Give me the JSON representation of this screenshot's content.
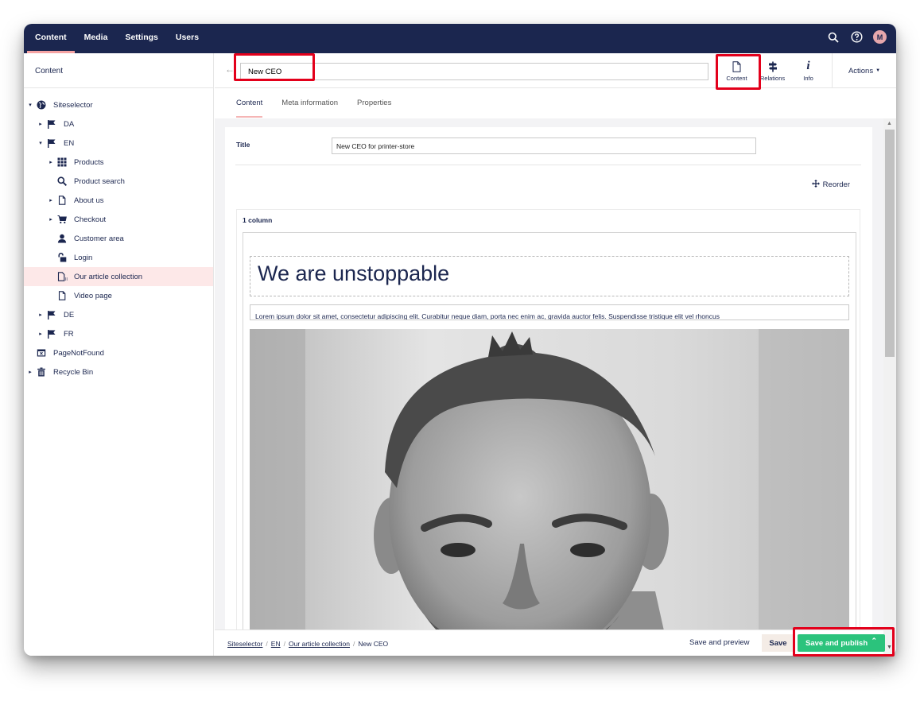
{
  "topbar": {
    "sections": [
      "Content",
      "Media",
      "Settings",
      "Users"
    ],
    "active_section": "Content",
    "icons": [
      "search-icon",
      "help-icon"
    ],
    "avatar_initial": "M",
    "colors": {
      "bar": "#1b264f",
      "active_underline": "#f5a3a3"
    }
  },
  "sidebar": {
    "header": "Content",
    "tree": [
      {
        "label": "Siteselector",
        "icon": "globe-icon",
        "caret": "▾"
      },
      {
        "label": "DA",
        "icon": "flag-icon",
        "caret": "▸"
      },
      {
        "label": "EN",
        "icon": "flag-icon",
        "caret": "▾"
      },
      {
        "label": "Products",
        "icon": "grid-icon",
        "caret": "▸"
      },
      {
        "label": "Product search",
        "icon": "search-icon",
        "caret": ""
      },
      {
        "label": "About us",
        "icon": "document-icon",
        "caret": "▸"
      },
      {
        "label": "Checkout",
        "icon": "cart-icon",
        "caret": "▸"
      },
      {
        "label": "Customer area",
        "icon": "user-icon",
        "caret": ""
      },
      {
        "label": "Login",
        "icon": "unlock-icon",
        "caret": ""
      },
      {
        "label": "Our article collection",
        "icon": "documents-icon",
        "caret": ""
      },
      {
        "label": "Video page",
        "icon": "document-icon",
        "caret": ""
      },
      {
        "label": "DE",
        "icon": "flag-icon",
        "caret": "▸"
      },
      {
        "label": "FR",
        "icon": "flag-icon",
        "caret": "▸"
      },
      {
        "label": "PageNotFound",
        "icon": "window-icon",
        "caret": ""
      },
      {
        "label": "Recycle Bin",
        "icon": "trash-icon",
        "caret": "▸"
      }
    ],
    "selected": "Our article collection"
  },
  "editor": {
    "name": "New CEO",
    "apps": [
      {
        "label": "Content",
        "icon": "document-icon"
      },
      {
        "label": "Relations",
        "icon": "signpost-icon"
      },
      {
        "label": "Info",
        "icon": "info-icon"
      }
    ],
    "actions_label": "Actions",
    "tabs": [
      "Content",
      "Meta information",
      "Properties"
    ],
    "active_tab": "Content"
  },
  "content": {
    "title_label": "Title",
    "title_value": "New CEO for printer-store",
    "reorder_label": "Reorder",
    "layout_label": "1 column",
    "heading": "We are unstoppable",
    "body_text": "Lorem ipsum dolor sit amet, consectetur adipiscing elit. Curabitur neque diam, porta nec enim ac, gravida auctor felis. Suspendisse tristique elit vel rhoncus"
  },
  "footer": {
    "breadcrumb": [
      "Siteselector",
      "EN",
      "Our article collection",
      "New CEO"
    ],
    "save_preview": "Save and preview",
    "save": "Save",
    "save_publish": "Save and publish",
    "publish_color": "#2bc37c"
  }
}
